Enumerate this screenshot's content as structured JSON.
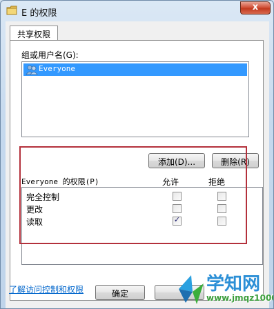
{
  "window": {
    "title": "E 的权限",
    "close_label": "x"
  },
  "tab": {
    "label": "共享权限"
  },
  "group_label": "组或用户名(G):",
  "users": [
    {
      "name": "Everyone",
      "selected": true
    }
  ],
  "buttons": {
    "add": "添加(D)...",
    "remove": "删除(R)",
    "ok": "确定",
    "partial": ""
  },
  "permissions": {
    "header": "Everyone 的权限(P)",
    "allow_header": "允许",
    "deny_header": "拒绝",
    "rows": [
      {
        "name": "完全控制",
        "allow": false,
        "deny": false
      },
      {
        "name": "更改",
        "allow": false,
        "deny": false
      },
      {
        "name": "读取",
        "allow": true,
        "deny": false
      }
    ]
  },
  "link": "了解访问控制和权限",
  "watermark": {
    "text": "学知网",
    "sub": "www.jmqz1000.com"
  },
  "colors": {
    "selection": "#3399ff",
    "highlight_box": "#b3303b",
    "link": "#0066cc"
  }
}
